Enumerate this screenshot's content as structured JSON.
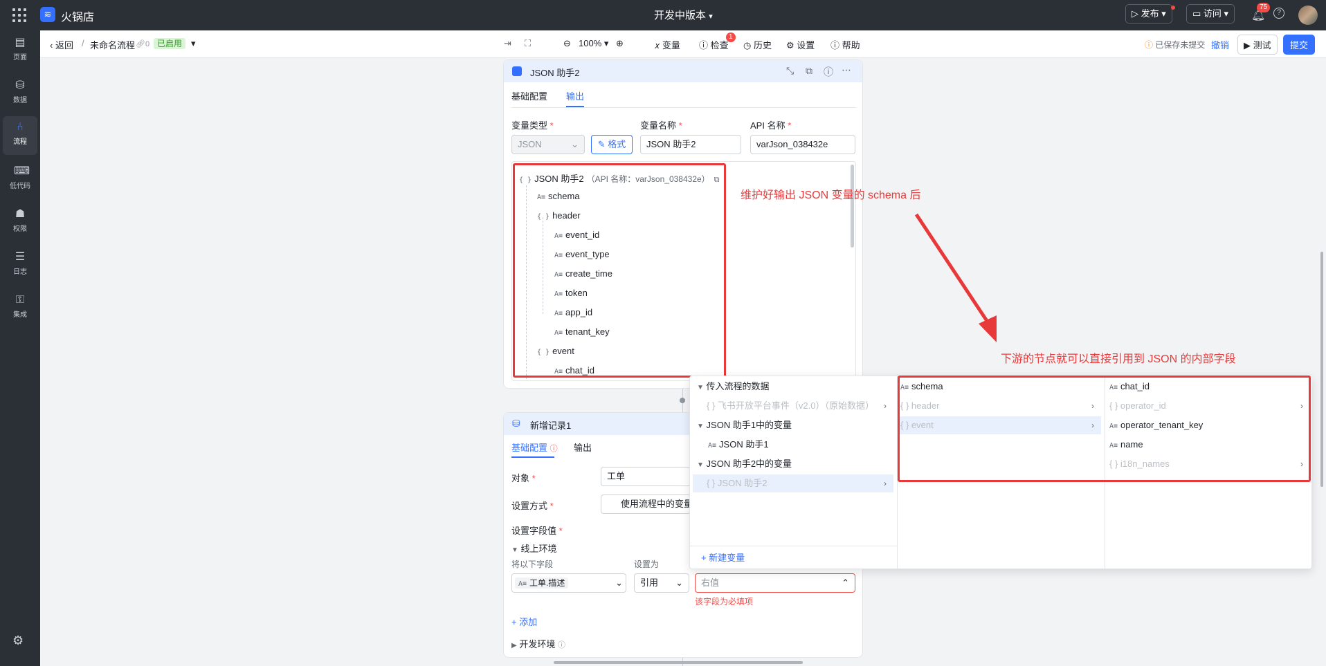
{
  "topbar": {
    "app_name": "火锅店",
    "version": "开发中版本",
    "version_arrow": "⌵",
    "publish": "发布",
    "visit": "访问",
    "notif_count": "75"
  },
  "sidebar": {
    "items": [
      {
        "label": "页面",
        "icon": "layout-icon"
      },
      {
        "label": "数据",
        "icon": "database-icon"
      },
      {
        "label": "流程",
        "icon": "flow-icon"
      },
      {
        "label": "低代码",
        "icon": "code-icon"
      },
      {
        "label": "权限",
        "icon": "users-icon"
      },
      {
        "label": "日志",
        "icon": "log-icon"
      },
      {
        "label": "集成",
        "icon": "key-icon"
      }
    ]
  },
  "toolbar": {
    "back": "返回",
    "sep": "/",
    "flow_name": "未命名流程",
    "link_count": "0",
    "status": "已启用",
    "zoom": "100%",
    "variables": "变量",
    "check": "检查",
    "check_badge": "1",
    "history": "历史",
    "settings": "设置",
    "help": "帮助",
    "save_state": "已保存未提交",
    "revoke": "撤销",
    "test": "测试",
    "submit": "提交"
  },
  "json_node": {
    "title": "JSON 助手2",
    "tabs": [
      "基础配置",
      "输出"
    ],
    "active_tab": "输出",
    "var_type_label": "变量类型",
    "var_type_value": "JSON",
    "format_btn": "格式",
    "var_name_label": "变量名称",
    "var_name_value": "JSON 助手2",
    "api_name_label": "API 名称",
    "api_name_value": "varJson_038432e",
    "tree": {
      "root": "JSON 助手2",
      "root_api": "（API 名称：varJson_038432e）",
      "items": [
        {
          "label": "schema",
          "type": "text",
          "depth": 1
        },
        {
          "label": "header",
          "type": "object",
          "depth": 1
        },
        {
          "label": "event_id",
          "type": "text",
          "depth": 2
        },
        {
          "label": "event_type",
          "type": "text",
          "depth": 2
        },
        {
          "label": "create_time",
          "type": "text",
          "depth": 2
        },
        {
          "label": "token",
          "type": "text",
          "depth": 2
        },
        {
          "label": "app_id",
          "type": "text",
          "depth": 2
        },
        {
          "label": "tenant_key",
          "type": "text",
          "depth": 2
        },
        {
          "label": "event",
          "type": "object",
          "depth": 1
        },
        {
          "label": "chat_id",
          "type": "text",
          "depth": 2
        }
      ]
    }
  },
  "record_node": {
    "title": "新增记录1",
    "tabs": [
      "基础配置",
      "输出"
    ],
    "object_label": "对象",
    "object_value": "工单",
    "method_label": "设置方式",
    "method_value": "使用流程中的变量",
    "fields_label": "设置字段值",
    "env_online": "线上环境",
    "col_field": "将以下字段",
    "col_set": "设置为",
    "field_value": "工单.描述",
    "set_value": "引用",
    "right_placeholder": "右值",
    "error": "该字段为必填项",
    "add": "添加",
    "env_dev": "开发环境"
  },
  "annotations": {
    "a1": "维护好输出 JSON 变量的 schema 后",
    "a2": "下游的节点就可以直接引用到 JSON 的内部字段"
  },
  "dropdown": {
    "col1": {
      "group1": "传入流程的数据",
      "item1": "飞书开放平台事件（v2.0）（原始数据）",
      "group2": "JSON 助手1中的变量",
      "item2": "JSON 助手1",
      "group3": "JSON 助手2中的变量",
      "item3": "JSON 助手2",
      "new_var": "新建变量"
    },
    "col2": [
      "schema",
      "header",
      "event"
    ],
    "col3": [
      "chat_id",
      "operator_id",
      "operator_tenant_key",
      "name",
      "i18n_names"
    ]
  }
}
